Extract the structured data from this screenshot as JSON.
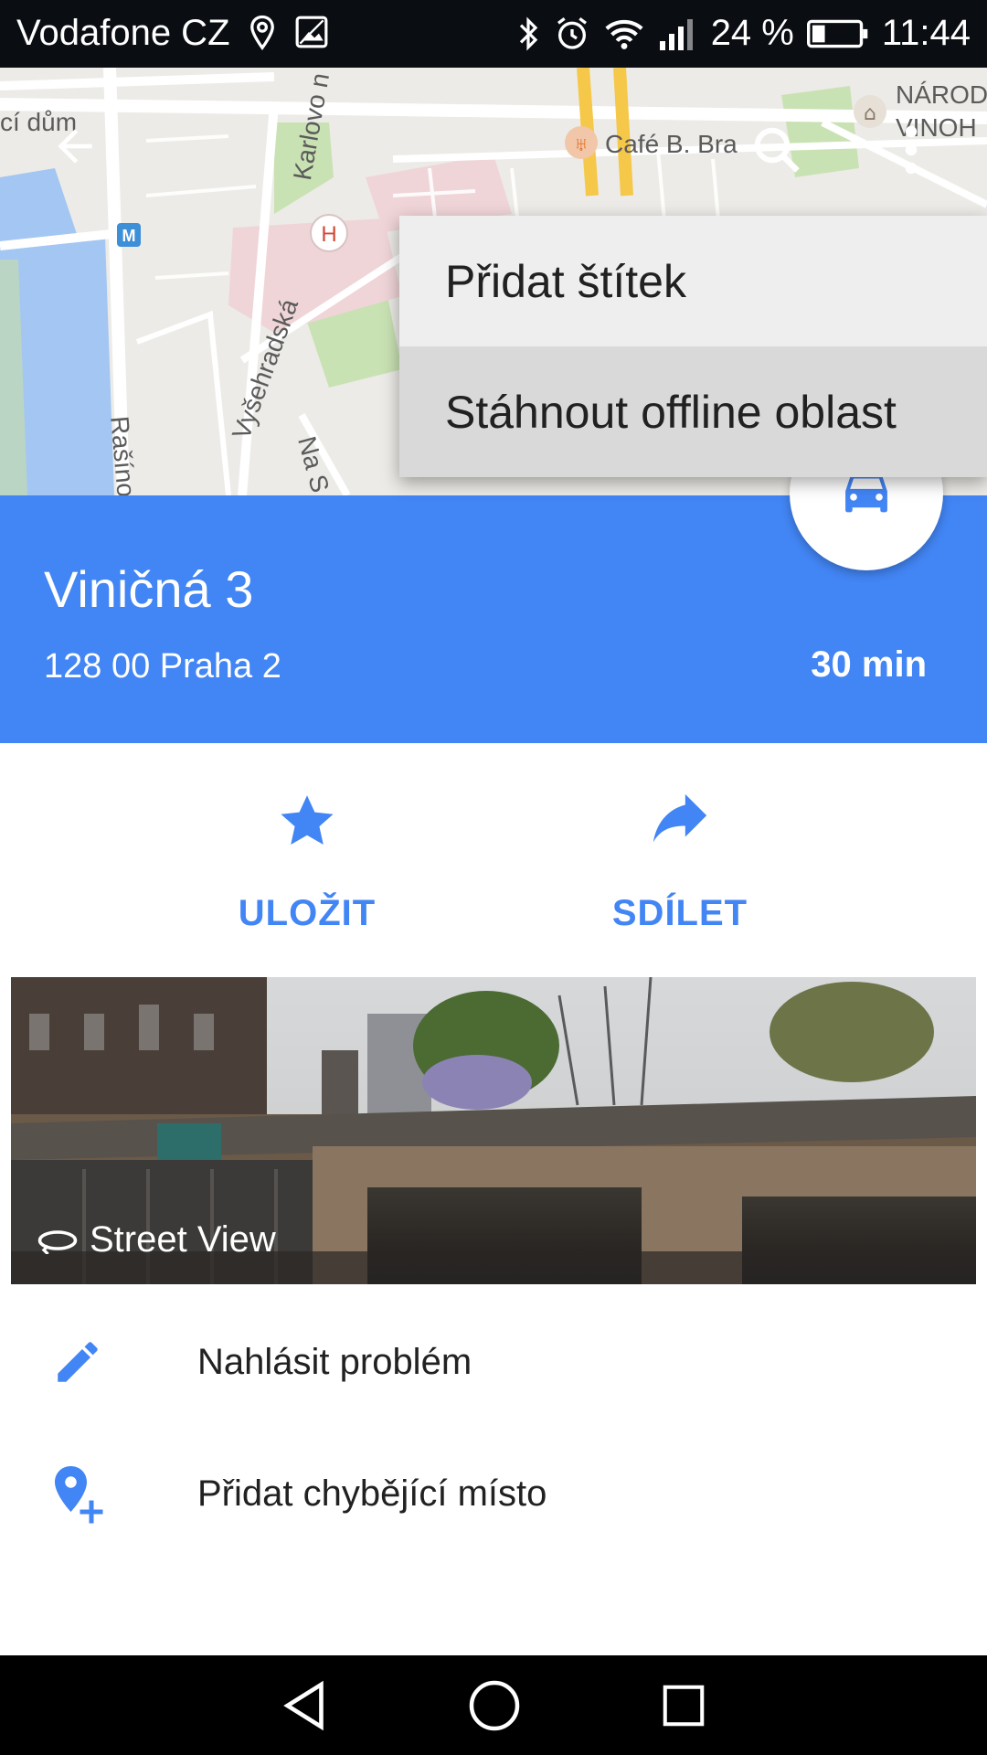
{
  "status_bar": {
    "carrier": "Vodafone CZ",
    "battery": "24 %",
    "time": "11:44",
    "icons": [
      "location-icon",
      "image-icon",
      "bluetooth-icon",
      "alarm-icon",
      "wifi-icon",
      "signal-icon",
      "battery-icon"
    ]
  },
  "map": {
    "labels": {
      "place_1": "cí dům",
      "street_1": "Karlovo n",
      "street_2": "Vyšehradská",
      "street_3": "Rašíno",
      "street_4": "Na S",
      "poi_1": "Café B. Bra",
      "poi_2": "NÁROD",
      "poi_3": "VINOH"
    }
  },
  "menu": {
    "items": [
      {
        "label": "Přidat štítek"
      },
      {
        "label": "Stáhnout offline oblast"
      }
    ]
  },
  "place": {
    "title": "Viničná 3",
    "address": "128 00 Praha 2",
    "travel_time": "30 min"
  },
  "actions": {
    "save_label": "ULOŽIT",
    "share_label": "SDÍLET"
  },
  "streetview": {
    "label": "Street View"
  },
  "list": {
    "items": [
      {
        "label": "Nahlásit problém"
      },
      {
        "label": "Přidat chybějící místo"
      }
    ]
  },
  "colors": {
    "accent": "#4285f4",
    "status_bar": "#0a0d12",
    "menu_bg": "#eeeeee",
    "menu_active": "#d9d9d9"
  }
}
